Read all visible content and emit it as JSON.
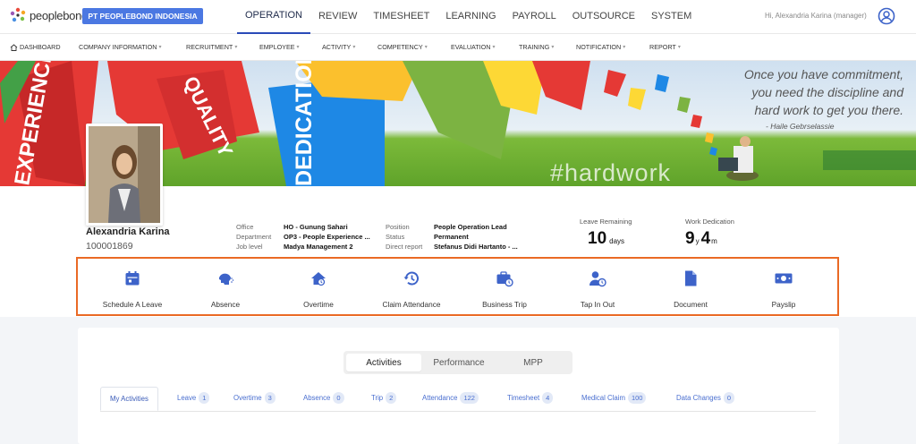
{
  "brand": {
    "logo_text": "peoplebond",
    "company": "PT PEOPLEBOND INDONESIA"
  },
  "main_nav": [
    "OPERATION",
    "REVIEW",
    "TIMESHEET",
    "LEARNING",
    "PAYROLL",
    "OUTSOURCE",
    "SYSTEM"
  ],
  "main_nav_active": "OPERATION",
  "greeting": "Hi, Alexandria Karina (manager)",
  "sub_nav": [
    "DASHBOARD",
    "COMPANY INFORMATION",
    "RECRUITMENT",
    "EMPLOYEE",
    "ACTIVITY",
    "COMPETENCY",
    "EVALUATION",
    "TRAINING",
    "NOTIFICATION",
    "REPORT"
  ],
  "banner": {
    "quote_lines": [
      "Once you have commitment,",
      "you need the discipline  and",
      "hard work to get you there."
    ],
    "author": "- Haile Gebrselassie",
    "hashtag": "#hardwork",
    "words": [
      "QUALITY",
      "EXPERIENCE",
      "DEDICATION"
    ]
  },
  "profile": {
    "name": "Alexandria Karina",
    "id": "100001869",
    "left_fields": [
      {
        "label": "Office",
        "value": "HO - Gunung Sahari"
      },
      {
        "label": "Department",
        "value": "OP3 - People Experience ..."
      },
      {
        "label": "Job level",
        "value": "Madya Management 2"
      }
    ],
    "right_fields": [
      {
        "label": "Position",
        "value": "People Operation Lead"
      },
      {
        "label": "Status",
        "value": "Permanent"
      },
      {
        "label": "Direct report",
        "value": "Stefanus Didi Hartanto - ..."
      }
    ],
    "leave": {
      "label": "Leave Remaining",
      "value": "10",
      "unit": "days"
    },
    "dedication": {
      "label": "Work Dedication",
      "years": "9",
      "years_unit": "y",
      "months": "4",
      "months_unit": "m"
    }
  },
  "quick_actions": [
    {
      "label": "Schedule A Leave",
      "icon": "calendar-icon"
    },
    {
      "label": "Absence",
      "icon": "absence-icon"
    },
    {
      "label": "Overtime",
      "icon": "overtime-icon"
    },
    {
      "label": "Claim Attendance",
      "icon": "history-icon"
    },
    {
      "label": "Business Trip",
      "icon": "briefcase-clock-icon"
    },
    {
      "label": "Tap In Out",
      "icon": "user-clock-icon"
    },
    {
      "label": "Document",
      "icon": "document-icon"
    },
    {
      "label": "Payslip",
      "icon": "money-icon"
    }
  ],
  "segment_tabs": [
    "Activities",
    "Performance",
    "MPP"
  ],
  "segment_active": "Activities",
  "activity_tabs": [
    {
      "label": "My Activities",
      "count": null
    },
    {
      "label": "Leave",
      "count": "1"
    },
    {
      "label": "Overtime",
      "count": "3"
    },
    {
      "label": "Absence",
      "count": "0"
    },
    {
      "label": "Trip",
      "count": "2"
    },
    {
      "label": "Attendance",
      "count": "122"
    },
    {
      "label": "Timesheet",
      "count": "4"
    },
    {
      "label": "Medical Claim",
      "count": "100"
    },
    {
      "label": "Data Changes",
      "count": "0"
    }
  ],
  "colors": {
    "primary": "#2a4bb8",
    "accent_border": "#ea6a25",
    "icon": "#3d63c9"
  }
}
